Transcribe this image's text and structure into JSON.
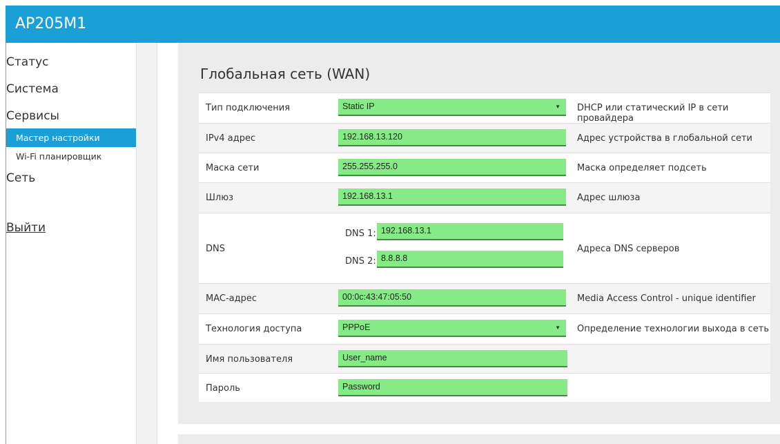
{
  "app": {
    "title": "AP205M1"
  },
  "sidebar": {
    "items": [
      {
        "label": "Статус"
      },
      {
        "label": "Система"
      },
      {
        "label": "Сервисы"
      },
      {
        "label": "Мастер настройки"
      },
      {
        "label": "Wi-Fi планировщик"
      },
      {
        "label": "Сеть"
      },
      {
        "label": "Выйти"
      }
    ]
  },
  "main": {
    "title": "Глобальная сеть (WAN)",
    "connection_type": {
      "label": "Тип подключения",
      "value": "Static IP",
      "desc": "DHCP или статический IP в сети провайдера"
    },
    "ipv4": {
      "label": "IPv4 адрес",
      "value": "192.168.13.120",
      "desc": "Адрес устройства в глобальной сети"
    },
    "mask": {
      "label": "Маска сети",
      "value": "255.255.255.0",
      "desc": "Маска определяет подсеть"
    },
    "gateway": {
      "label": "Шлюз",
      "value": "192.168.13.1",
      "desc": "Адрес шлюза"
    },
    "dns": {
      "label": "DNS",
      "dns1_label": "DNS 1:",
      "dns1_value": "192.168.13.1",
      "dns2_label": "DNS 2:",
      "dns2_value": "8.8.8.8",
      "desc": "Адреса DNS серверов"
    },
    "mac": {
      "label": "MAC-адрес",
      "value": "00:0c:43:47:05:50",
      "desc": "Media Access Control - unique identifier"
    },
    "access_tech": {
      "label": "Технология доступа",
      "value": "PPPoE",
      "desc": "Определение технологии выхода в сеть"
    },
    "username": {
      "label": "Имя пользователя",
      "value": "User_name"
    },
    "password": {
      "label": "Пароль",
      "value": "Password"
    }
  },
  "colors": {
    "accent": "#1a9fd6",
    "field_bg": "#86ea86",
    "field_border": "#3a8f3a"
  }
}
